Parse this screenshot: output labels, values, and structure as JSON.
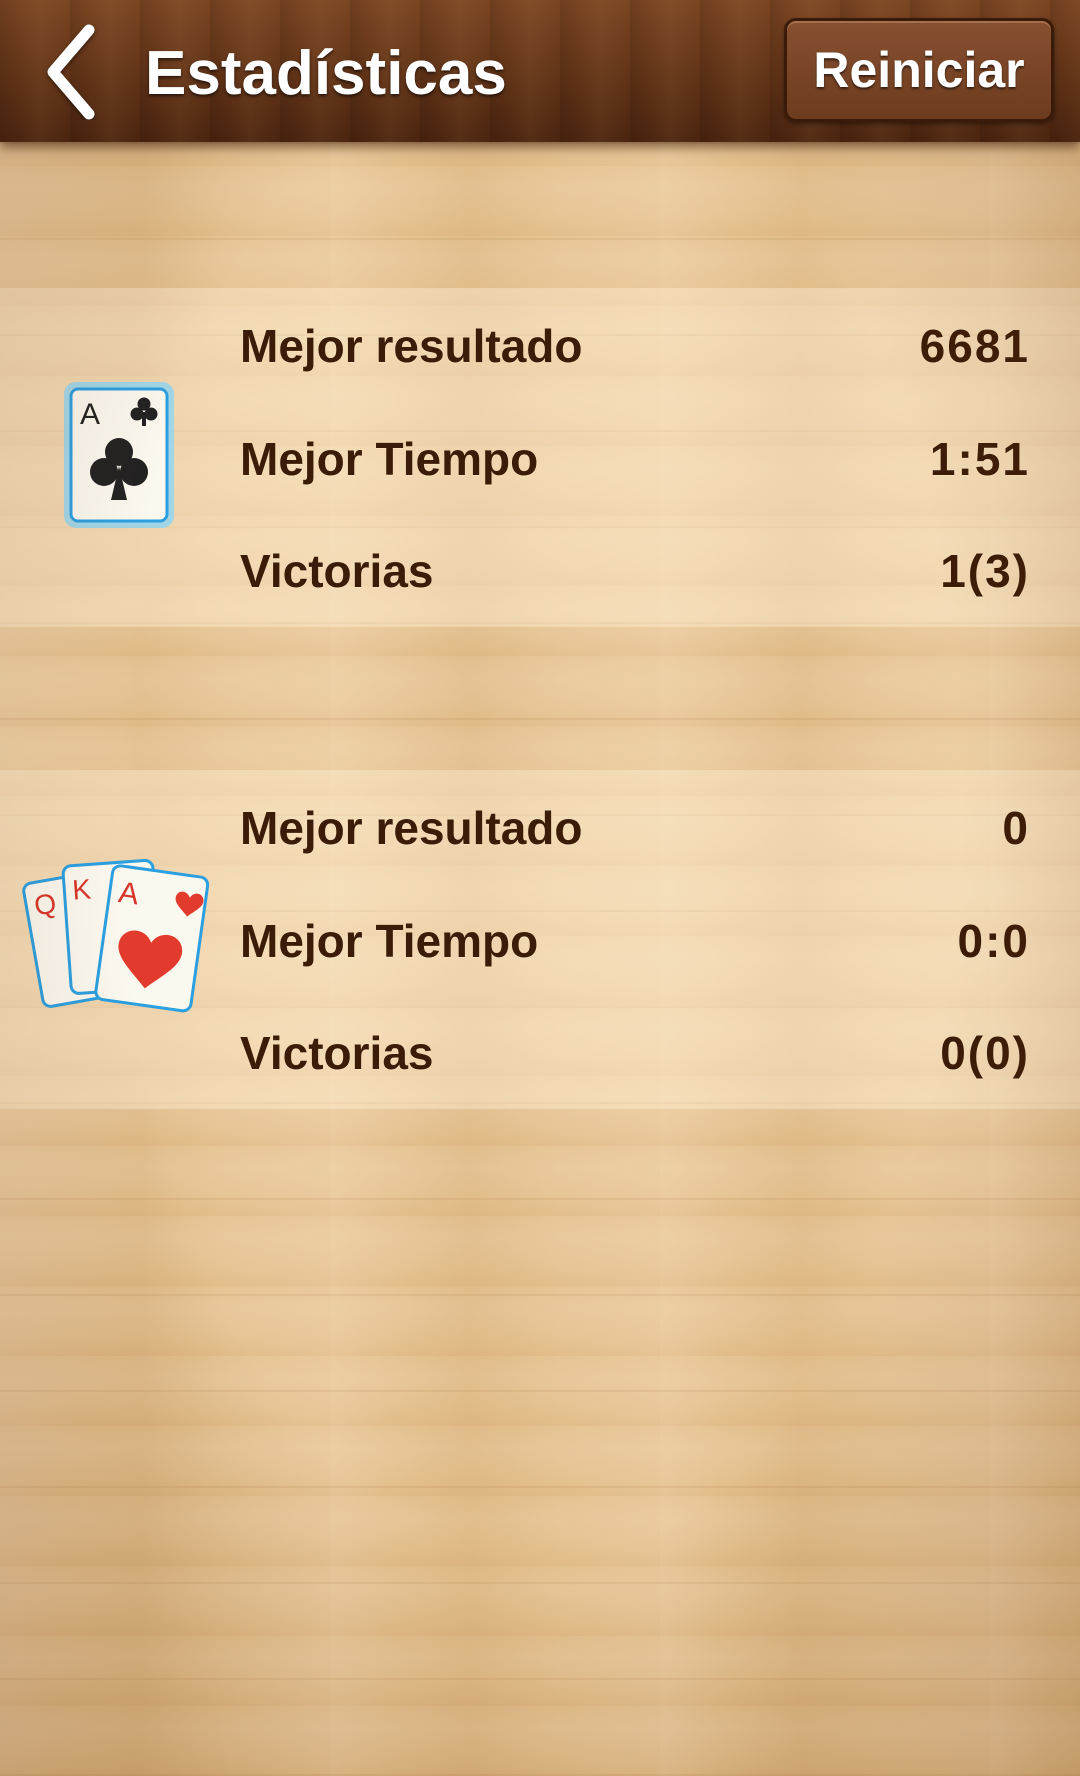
{
  "header": {
    "title": "Estadísticas",
    "reset_label": "Reiniciar"
  },
  "games": [
    {
      "icon": "ace-of-clubs-card-icon",
      "card_rank": "A",
      "stats": [
        {
          "label": "Mejor resultado",
          "value": "6681"
        },
        {
          "label": "Mejor Tiempo",
          "value": "1:51"
        },
        {
          "label": "Victorias",
          "value": "1(3)"
        }
      ]
    },
    {
      "icon": "three-cards-hearts-icon",
      "card_ranks": [
        "Q",
        "K",
        "A"
      ],
      "stats": [
        {
          "label": "Mejor resultado",
          "value": "0"
        },
        {
          "label": "Mejor Tiempo",
          "value": "0:0"
        },
        {
          "label": "Victorias",
          "value": "0(0)"
        }
      ]
    }
  ],
  "colors": {
    "header_bg": "#5e3116",
    "text_dark": "#3b1c08",
    "heart_red": "#e23b2e",
    "card_glow": "#7fd6ff"
  }
}
